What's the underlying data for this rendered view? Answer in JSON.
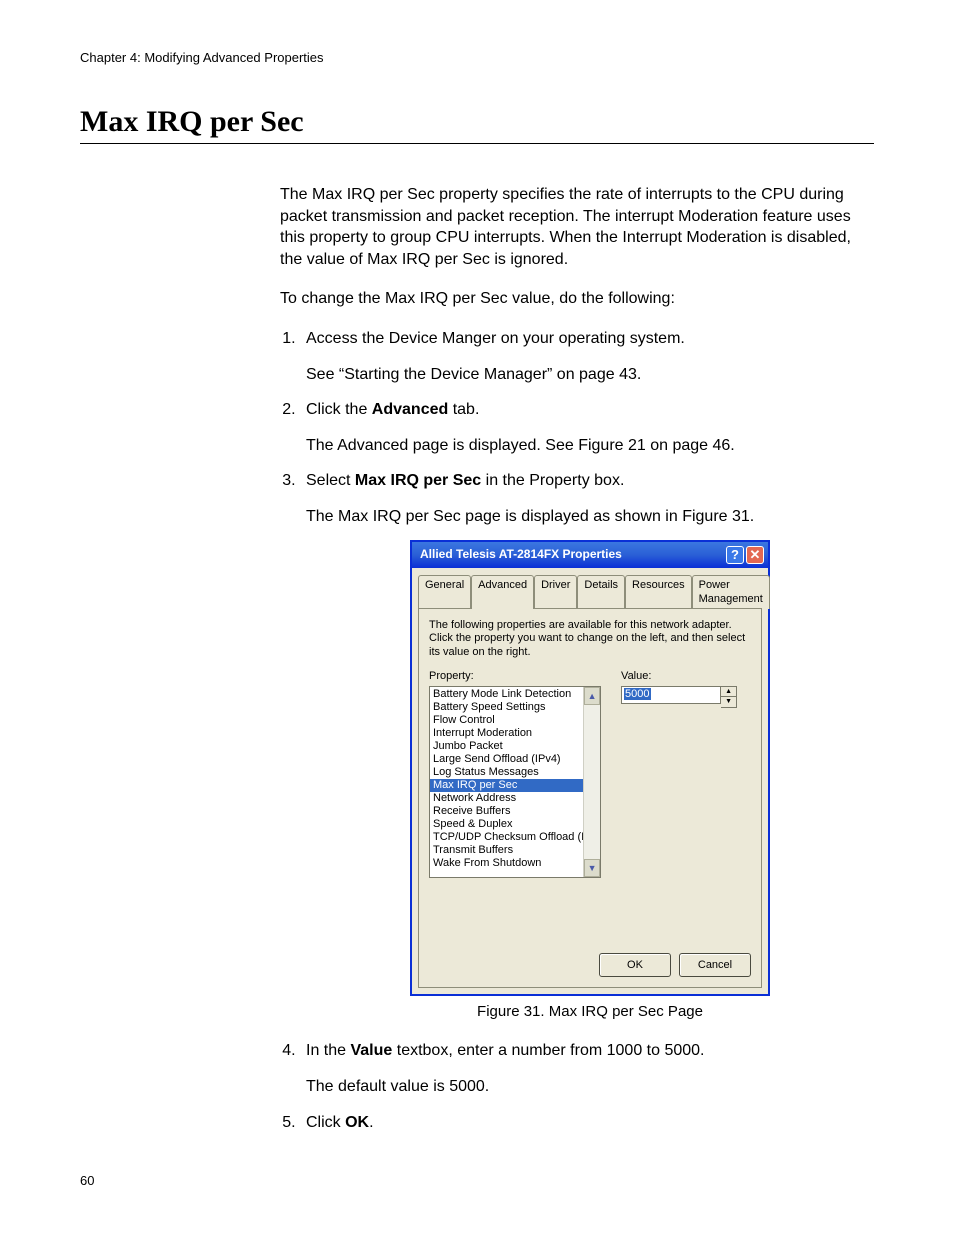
{
  "header": {
    "chapter": "Chapter 4: Modifying Advanced Properties"
  },
  "title": "Max IRQ per Sec",
  "intro": "The Max IRQ per Sec property specifies the rate of interrupts to the CPU during packet transmission and packet reception. The interrupt Moderation feature uses this property to group CPU interrupts. When the Interrupt Moderation is disabled, the value of Max IRQ per Sec is ignored.",
  "lead": "To change the Max IRQ per Sec value, do the following:",
  "steps": {
    "s1": {
      "text": "Access the Device Manger on your operating system.",
      "sub": "See “Starting the Device Manager” on page 43."
    },
    "s2": {
      "pre": "Click the ",
      "bold": "Advanced",
      "post": " tab.",
      "sub": "The Advanced page is displayed. See Figure 21 on page 46."
    },
    "s3": {
      "pre": "Select ",
      "bold": "Max IRQ per Sec",
      "post": " in the Property box.",
      "sub": "The Max IRQ per Sec page is displayed as shown in Figure 31."
    },
    "s4": {
      "pre": "In the ",
      "bold": "Value",
      "post": " textbox, enter a number from 1000 to 5000.",
      "sub": "The default value is 5000."
    },
    "s5": {
      "pre": "Click ",
      "bold": "OK",
      "post": "."
    }
  },
  "figure": {
    "caption": "Figure 31. Max IRQ per Sec Page"
  },
  "dialog": {
    "title": "Allied Telesis AT-2814FX Properties",
    "tabs": [
      "General",
      "Advanced",
      "Driver",
      "Details",
      "Resources",
      "Power Management"
    ],
    "active_tab": "Advanced",
    "description": "The following properties are available for this network adapter. Click the property you want to change on the left, and then select its value on the right.",
    "property_label": "Property:",
    "value_label": "Value:",
    "properties": [
      "Battery Mode Link Detection",
      "Battery Speed Settings",
      "Flow Control",
      "Interrupt Moderation",
      "Jumbo Packet",
      "Large Send Offload (IPv4)",
      "Log Status Messages",
      "Max IRQ per Sec",
      "Network Address",
      "Receive Buffers",
      "Speed & Duplex",
      "TCP/UDP Checksum Offload (IPv",
      "Transmit Buffers",
      "Wake From Shutdown"
    ],
    "selected_property": "Max IRQ per Sec",
    "value": "5000",
    "ok": "OK",
    "cancel": "Cancel"
  },
  "page_number": "60"
}
